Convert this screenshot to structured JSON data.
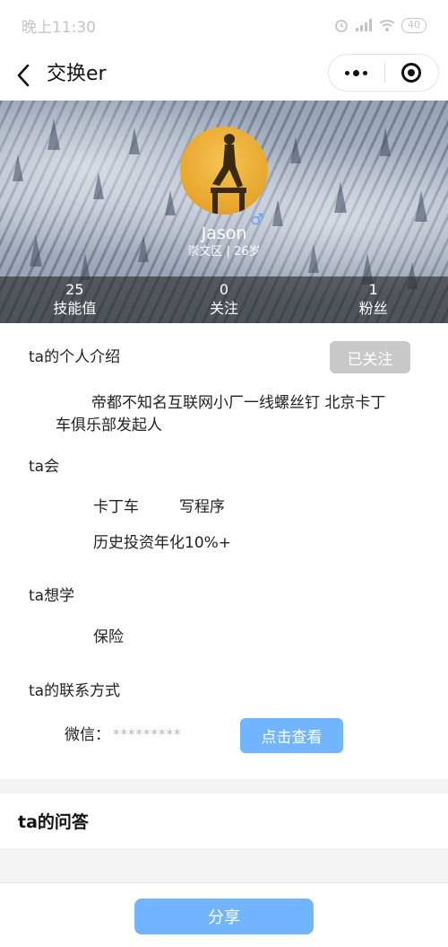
{
  "status_bar": {
    "time": "晚上11:30",
    "battery": "40"
  },
  "nav": {
    "title": "交换er"
  },
  "profile": {
    "name": "Jason",
    "gender_symbol": "♂",
    "district_age": "崇文区 | 26岁",
    "stats": [
      {
        "value": "25",
        "label": "技能值"
      },
      {
        "value": "0",
        "label": "关注"
      },
      {
        "value": "1",
        "label": "粉丝"
      }
    ]
  },
  "intro": {
    "title": "ta的个人介绍",
    "follow_button": "已关注",
    "text": "帝都不知名互联网小厂一线螺丝钉 北京卡丁车俱乐部发起人"
  },
  "skills": {
    "title": "ta会",
    "items": [
      "卡丁车",
      "写程序",
      "历史投资年化10%+"
    ]
  },
  "wants": {
    "title": "ta想学",
    "items": [
      "保险"
    ]
  },
  "contact": {
    "title": "ta的联系方式",
    "wechat_label": "微信：",
    "wechat_masked": "*********",
    "view_button": "点击查看"
  },
  "qa": {
    "title": "ta的问答"
  },
  "footer": {
    "share_button": "分享"
  },
  "colors": {
    "accent": "#71b4ff",
    "followed_bg": "#c8c8c8",
    "gender": "#5ea3ff"
  }
}
